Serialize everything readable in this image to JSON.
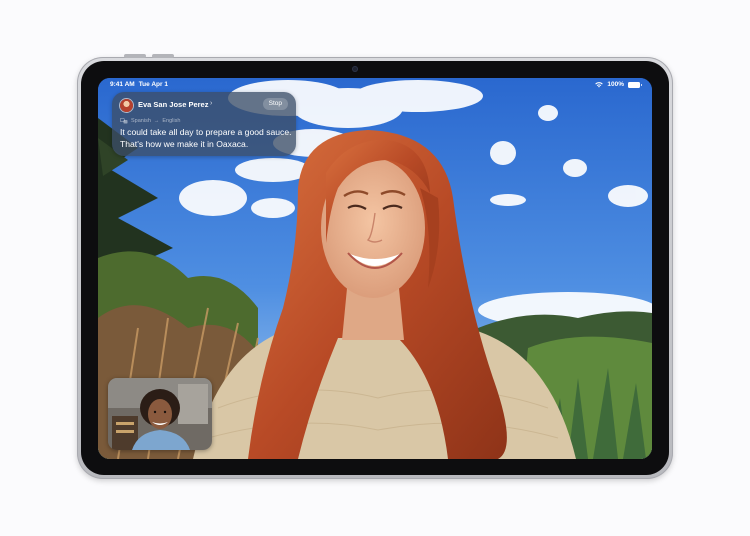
{
  "status_bar": {
    "time": "9:41 AM",
    "date": "Tue Apr 1",
    "battery": "100%"
  },
  "caption": {
    "caller_name": "Eva San Jose Perez",
    "stop_label": "Stop",
    "source_language": "Spanish",
    "arrow": "→",
    "target_language": "English",
    "text": "It could take all day to prepare a good sauce. That's how we make it in Oaxaca."
  },
  "colors": {
    "sky": "#3d7fd9",
    "hair": "#c8572f",
    "sweater": "#d8c7a8",
    "caption_bg": "#3c4e68",
    "device_frame": "#c9cacf"
  },
  "icons": [
    "wifi-icon",
    "battery-icon",
    "chevron-right-icon",
    "translate-icon",
    "camera-icon"
  ]
}
